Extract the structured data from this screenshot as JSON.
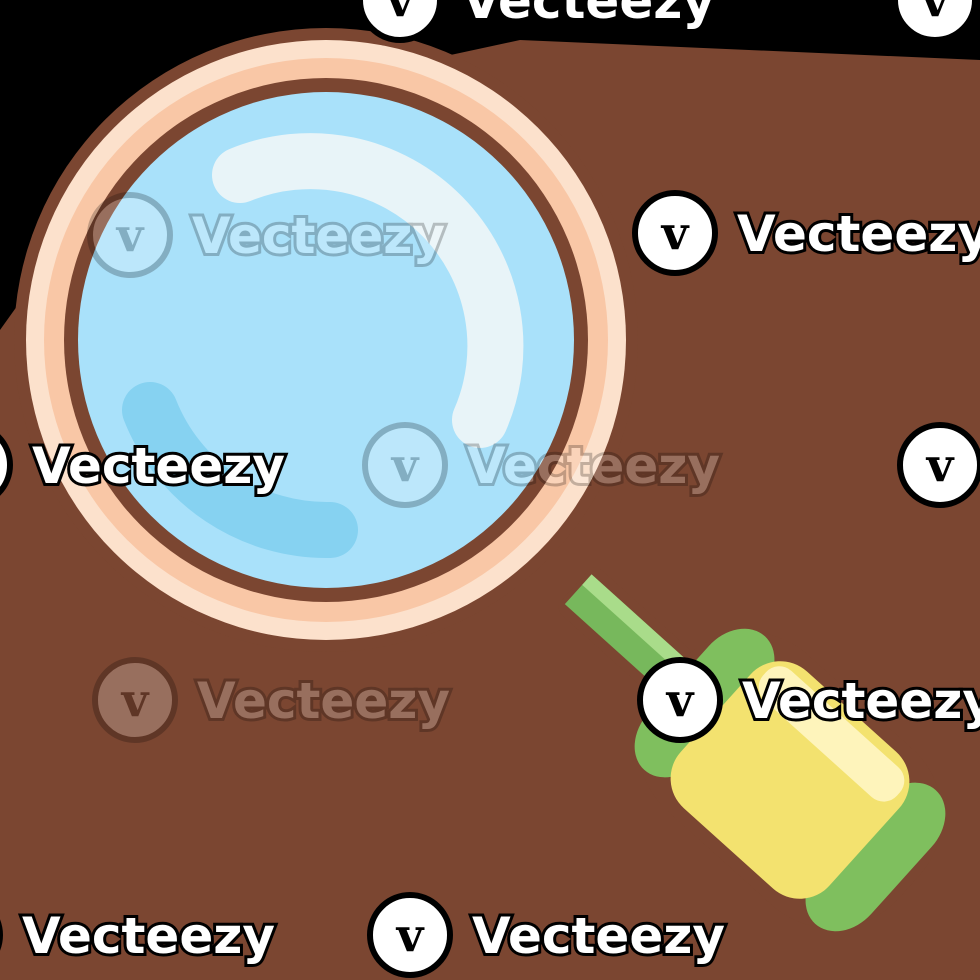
{
  "illustration": {
    "subject": "magnifying-glass-icon",
    "colors": {
      "background": "#000000",
      "outline": "#7B4631",
      "rim_outer": "#FCE1CC",
      "rim_inner": "#F9C7A6",
      "lens": "#A9E1FA",
      "lens_highlight": "#E8F4F8",
      "lens_shadow": "#86D2F1",
      "neck": "#77B85C",
      "neck_highlight": "#A9DC8A",
      "grip": "#F3E26F",
      "grip_highlight": "#FFF7C9",
      "grip_cap": "#7FBF5E"
    }
  },
  "watermarks": [
    {
      "text": "Vecteezy",
      "style": "solid"
    },
    {
      "text": "Vecteezy",
      "style": "solid"
    },
    {
      "text": "Vecteezy",
      "style": "solid"
    },
    {
      "text": "Vecteezy",
      "style": "faded"
    },
    {
      "text": "Vecteezy",
      "style": "solid"
    },
    {
      "text": "Vecteezy",
      "style": "faded"
    },
    {
      "text": "Vecteezy",
      "style": "solid"
    },
    {
      "text": "Vecteezy",
      "style": "faded"
    },
    {
      "text": "Vecteezy",
      "style": "solid"
    },
    {
      "text": "Vecteezy",
      "style": "solid"
    },
    {
      "text": "Vecteezy",
      "style": "solid"
    }
  ]
}
